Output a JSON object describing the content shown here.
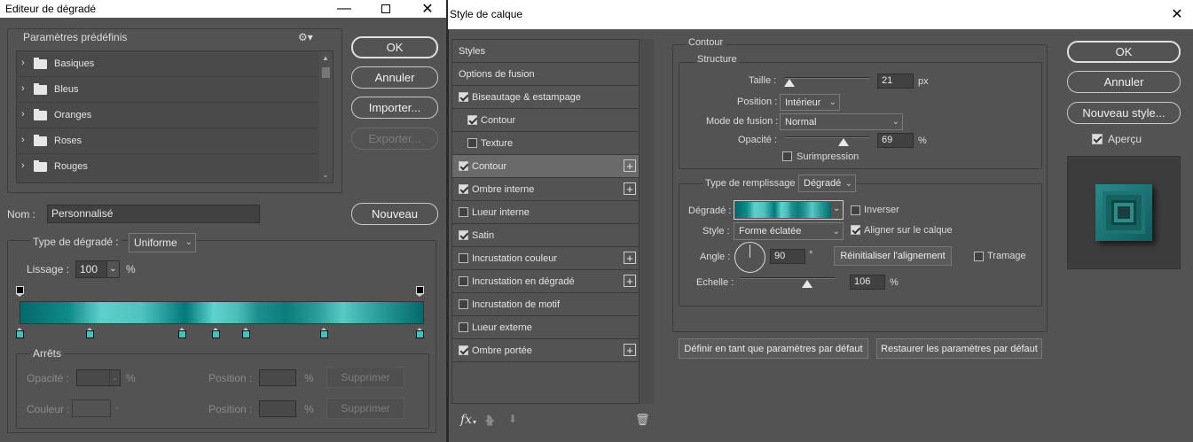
{
  "gradient_editor": {
    "title": "Editeur de dégradé",
    "presets_label": "Paramètres prédéfinis",
    "presets": [
      "Basiques",
      "Bleus",
      "Oranges",
      "Roses",
      "Rouges"
    ],
    "buttons": {
      "ok": "OK",
      "cancel": "Annuler",
      "import": "Importer...",
      "export": "Exporter...",
      "new": "Nouveau"
    },
    "name_label": "Nom :",
    "name_value": "Personnalisé",
    "gradient_type_label": "Type de dégradé :",
    "gradient_type_value": "Uniforme",
    "smoothing_label": "Lissage :",
    "smoothing_value": "100",
    "smoothing_unit": "%",
    "stops_label": "Arrêts",
    "opacity_label": "Opacité :",
    "color_label": "Couleur :",
    "position_label": "Position :",
    "percent": "%",
    "delete_label": "Supprimer"
  },
  "layer_style": {
    "title": "Style de calque",
    "styles_header": "Styles",
    "items": [
      {
        "label": "Options de fusion",
        "checkbox": false,
        "checked": false,
        "plus": false,
        "indent": false,
        "selected": false
      },
      {
        "label": "Biseautage & estampage",
        "checkbox": true,
        "checked": true,
        "plus": false,
        "indent": false,
        "selected": false
      },
      {
        "label": "Contour",
        "checkbox": true,
        "checked": true,
        "plus": false,
        "indent": true,
        "selected": false
      },
      {
        "label": "Texture",
        "checkbox": true,
        "checked": false,
        "plus": false,
        "indent": true,
        "selected": false
      },
      {
        "label": "Contour",
        "checkbox": true,
        "checked": true,
        "plus": true,
        "indent": false,
        "selected": true
      },
      {
        "label": "Ombre interne",
        "checkbox": true,
        "checked": true,
        "plus": true,
        "indent": false,
        "selected": false
      },
      {
        "label": "Lueur interne",
        "checkbox": true,
        "checked": false,
        "plus": false,
        "indent": false,
        "selected": false
      },
      {
        "label": "Satin",
        "checkbox": true,
        "checked": true,
        "plus": false,
        "indent": false,
        "selected": false
      },
      {
        "label": "Incrustation couleur",
        "checkbox": true,
        "checked": false,
        "plus": true,
        "indent": false,
        "selected": false
      },
      {
        "label": "Incrustation en dégradé",
        "checkbox": true,
        "checked": false,
        "plus": true,
        "indent": false,
        "selected": false
      },
      {
        "label": "Incrustation de motif",
        "checkbox": true,
        "checked": false,
        "plus": false,
        "indent": false,
        "selected": false
      },
      {
        "label": "Lueur externe",
        "checkbox": true,
        "checked": false,
        "plus": false,
        "indent": false,
        "selected": false
      },
      {
        "label": "Ombre portée",
        "checkbox": true,
        "checked": true,
        "plus": true,
        "indent": false,
        "selected": false
      }
    ],
    "fx_label": "fx",
    "contour": {
      "group": "Contour",
      "structure": "Structure",
      "size_label": "Taille :",
      "size_value": "21",
      "size_unit": "px",
      "size_fraction": 0.055,
      "position_label": "Position :",
      "position_value": "Intérieur",
      "blend_label": "Mode de fusion :",
      "blend_value": "Normal",
      "opacity_label": "Opacité :",
      "opacity_value": "69",
      "opacity_unit": "%",
      "opacity_fraction": 0.69,
      "overprint_label": "Surimpression",
      "fill_type_label": "Type de remplissage :",
      "fill_type_value": "Dégradé",
      "gradient_label": "Dégradé :",
      "reverse_label": "Inverser",
      "style_label": "Style :",
      "style_value": "Forme éclatée",
      "align_label": "Aligner sur le calque",
      "angle_label": "Angle :",
      "angle_value": "90",
      "angle_unit": "°",
      "reset_align_label": "Réinitialiser l'alignement",
      "dither_label": "Tramage",
      "scale_label": "Echelle :",
      "scale_value": "106",
      "scale_unit": "%",
      "scale_fraction": 0.7,
      "set_default_label": "Définir en tant que paramètres par défaut",
      "reset_default_label": "Restaurer les paramètres par défaut"
    },
    "buttons": {
      "ok": "OK",
      "cancel": "Annuler",
      "new_style": "Nouveau style..."
    },
    "preview_label": "Aperçu"
  },
  "colors": {
    "teal_dark": "#05696b",
    "teal_light": "#5ecfcb"
  }
}
